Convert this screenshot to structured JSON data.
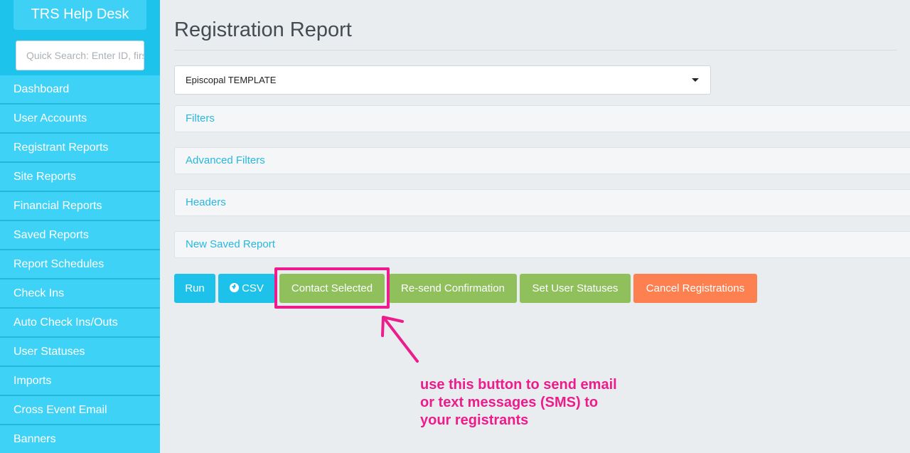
{
  "sidebar": {
    "brand": "TRS Help Desk",
    "search_placeholder": "Quick Search: Enter ID, first",
    "items": [
      "Dashboard",
      "User Accounts",
      "Registrant Reports",
      "Site Reports",
      "Financial Reports",
      "Saved Reports",
      "Report Schedules",
      "Check Ins",
      "Auto Check Ins/Outs",
      "User Statuses",
      "Imports",
      "Cross Event Email",
      "Banners"
    ]
  },
  "main": {
    "title": "Registration Report",
    "template_select": "Episcopal TEMPLATE",
    "panels": [
      "Filters",
      "Advanced Filters",
      "Headers",
      "New Saved Report"
    ],
    "buttons": {
      "run": "Run",
      "csv": "CSV",
      "contact_selected": "Contact Selected",
      "resend_confirmation": "Re-send Confirmation",
      "set_user_statuses": "Set User Statuses",
      "cancel_registrations": "Cancel Registrations"
    }
  },
  "annotation": {
    "line1": "use this button to send email",
    "line2": "or text messages (SMS) to",
    "line3": "your registrants"
  },
  "colors": {
    "sidebar": "#1ec3ec",
    "primary": "#1ec1e9",
    "success": "#8fc05c",
    "warning": "#fc8050",
    "annotation": "#ed1c8c"
  }
}
